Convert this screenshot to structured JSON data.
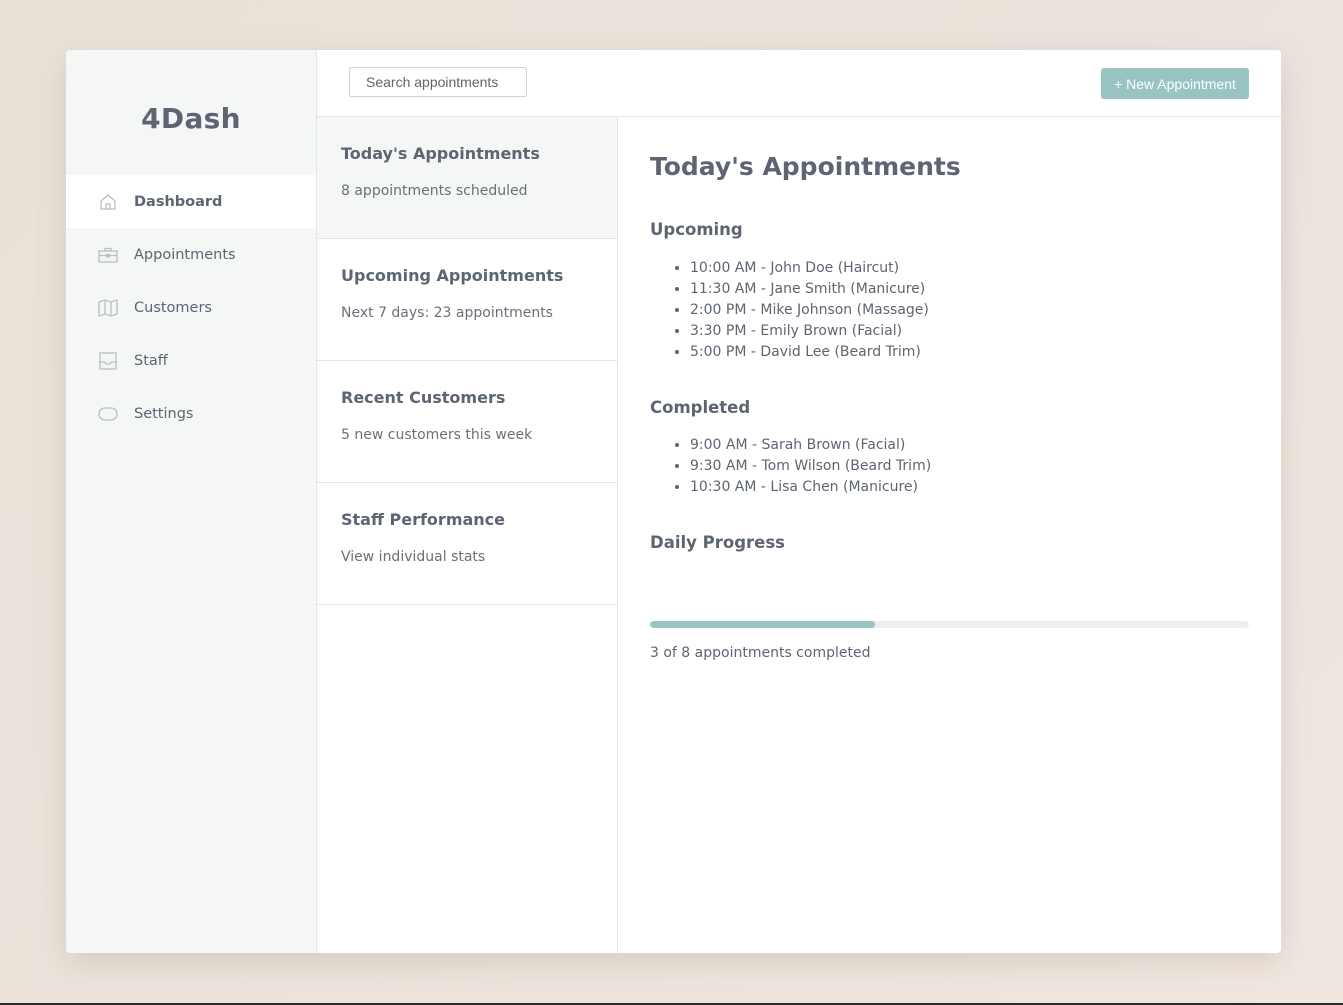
{
  "app": {
    "logo": "4Dash",
    "accent_color": "#98c4c1"
  },
  "sidebar": {
    "items": [
      {
        "label": "Dashboard",
        "icon": "home-icon",
        "active": true
      },
      {
        "label": "Appointments",
        "icon": "briefcase-icon",
        "active": false
      },
      {
        "label": "Customers",
        "icon": "map-icon",
        "active": false
      },
      {
        "label": "Staff",
        "icon": "inbox-icon",
        "active": false
      },
      {
        "label": "Settings",
        "icon": "toggle-icon",
        "active": false
      }
    ]
  },
  "topbar": {
    "search_placeholder": "Search appointments",
    "new_button_label": "+ New Appointment"
  },
  "cards": [
    {
      "title": "Today's Appointments",
      "desc": "8 appointments scheduled",
      "active": true
    },
    {
      "title": "Upcoming Appointments",
      "desc": "Next 7 days: 23 appointments",
      "active": false
    },
    {
      "title": "Recent Customers",
      "desc": "5 new customers this week",
      "active": false
    },
    {
      "title": "Staff Performance",
      "desc": "View individual stats",
      "active": false
    }
  ],
  "detail": {
    "title": "Today's Appointments",
    "upcoming_heading": "Upcoming",
    "upcoming": [
      "10:00 AM - John Doe (Haircut)",
      "11:30 AM - Jane Smith (Manicure)",
      "2:00 PM - Mike Johnson (Massage)",
      "3:30 PM - Emily Brown (Facial)",
      "5:00 PM - David Lee (Beard Trim)"
    ],
    "completed_heading": "Completed",
    "completed": [
      "9:00 AM - Sarah Brown (Facial)",
      "9:30 AM - Tom Wilson (Beard Trim)",
      "10:30 AM - Lisa Chen (Manicure)"
    ],
    "progress_heading": "Daily Progress",
    "progress_fraction": 0.375,
    "progress_text": "3 of 8 appointments completed"
  }
}
